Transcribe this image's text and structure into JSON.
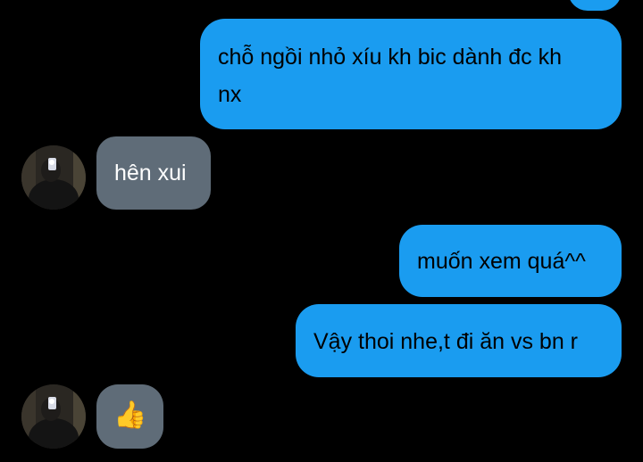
{
  "colors": {
    "background": "#000000",
    "outgoing_bubble": "#1a9cf0",
    "incoming_bubble": "#5f6c78",
    "outgoing_text": "#000000",
    "incoming_text": "#ffffff"
  },
  "messages": [
    {
      "direction": "outgoing",
      "line1": "chỗ ngồi nhỏ xíu kh bic dành đc kh",
      "line2": "nx"
    },
    {
      "direction": "incoming",
      "text": "hên xui",
      "avatar": "contact-avatar"
    },
    {
      "direction": "outgoing",
      "text": "muốn xem quá^^"
    },
    {
      "direction": "outgoing",
      "text": "Vậy thoi nhe,t đi ăn vs bn r"
    },
    {
      "direction": "incoming",
      "text": "👍",
      "icon": "thumbs-up-icon",
      "avatar": "contact-avatar"
    }
  ]
}
